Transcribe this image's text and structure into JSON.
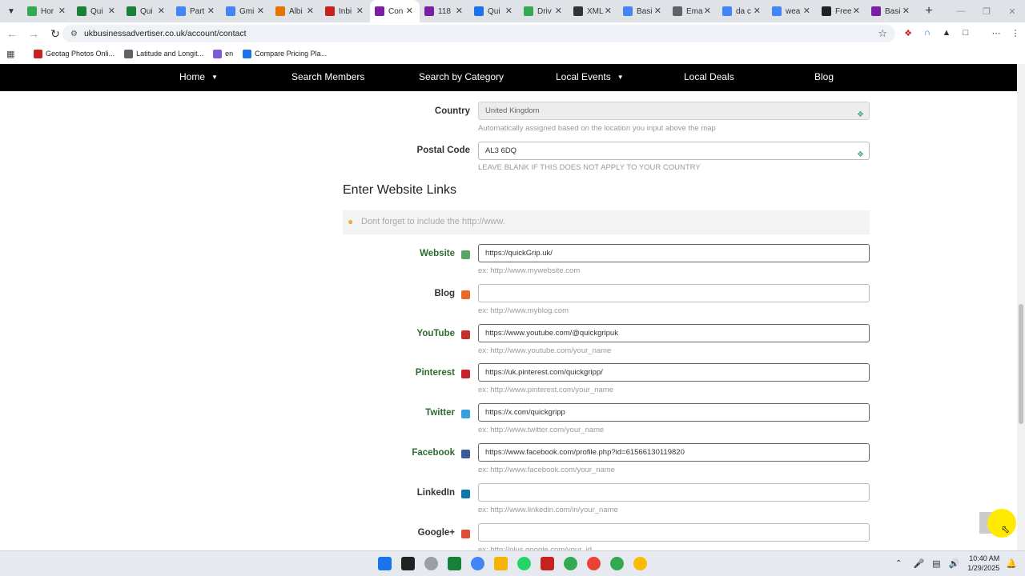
{
  "browser": {
    "tabs": [
      {
        "title": "Hor",
        "color": "#34a853"
      },
      {
        "title": "Qui",
        "color": "#188038"
      },
      {
        "title": "Qui",
        "color": "#188038"
      },
      {
        "title": "Part",
        "color": "#4285f4"
      },
      {
        "title": "Gmi",
        "color": "#4285f4"
      },
      {
        "title": "Albi",
        "color": "#e37400"
      },
      {
        "title": "Inbi",
        "color": "#c5221f"
      },
      {
        "title": "Con",
        "color": "#7b1fa2",
        "active": true
      },
      {
        "title": "118",
        "color": "#7b1fa2"
      },
      {
        "title": "Qui",
        "color": "#1a73e8"
      },
      {
        "title": "Driv",
        "color": "#34a853"
      },
      {
        "title": "XML",
        "color": "#333333"
      },
      {
        "title": "Basi",
        "color": "#4285f4"
      },
      {
        "title": "Ema",
        "color": "#5f6368"
      },
      {
        "title": "da c",
        "color": "#4285f4"
      },
      {
        "title": "wea",
        "color": "#4285f4"
      },
      {
        "title": "Free",
        "color": "#202124"
      },
      {
        "title": "Basi",
        "color": "#7b1fa2"
      }
    ],
    "new_tab": "+",
    "url": "ukbusinessadvertiser.co.uk/account/contact",
    "bookmarks": [
      {
        "label": "Geotag Photos Onli...",
        "color": "#c5221f"
      },
      {
        "label": "Latitude and Longit...",
        "color": "#5f6368"
      },
      {
        "label": "en",
        "color": "#7b5bd6"
      },
      {
        "label": "Compare Pricing Pla...",
        "color": "#1a73e8"
      }
    ]
  },
  "site_nav": {
    "items": [
      "Home",
      "Search Members",
      "Search by Category",
      "Local Events",
      "Local Deals",
      "Blog"
    ]
  },
  "location": {
    "country_label": "Country",
    "country_value": "United Kingdom",
    "country_help": "Automatically assigned based on the location you input above the map",
    "postal_label": "Postal Code",
    "postal_value": "AL3 6DQ",
    "postal_help": "LEAVE BLANK IF THIS DOES NOT APPLY TO YOUR COUNTRY"
  },
  "links": {
    "section_title": "Enter Website Links",
    "tip": "Dont forget to include the http://www.",
    "rows": [
      {
        "label": "Website",
        "value": "https://quickGrip.uk/",
        "help": "ex: http://www.mywebsite.com",
        "icon_color": "#5aa469",
        "icon": "website-icon"
      },
      {
        "label": "Blog",
        "value": "",
        "help": "ex: http://www.myblog.com",
        "icon_color": "#e86a2b",
        "icon": "blog-icon"
      },
      {
        "label": "YouTube",
        "value": "https://www.youtube.com/@quickgripuk",
        "help": "ex: http://www.youtube.com/your_name",
        "icon_color": "#c4302b",
        "icon": "youtube-icon"
      },
      {
        "label": "Pinterest",
        "value": "https://uk.pinterest.com/quickgripp/",
        "help": "ex: http://www.pinterest.com/your_name",
        "icon_color": "#c8232c",
        "icon": "pinterest-icon"
      },
      {
        "label": "Twitter",
        "value": "https://x.com/quickgripp",
        "help": "ex: http://www.twitter.com/your_name",
        "icon_color": "#3a9fdd",
        "icon": "twitter-icon"
      },
      {
        "label": "Facebook",
        "value": "https://www.facebook.com/profile.php?id=61566130119820",
        "help": "ex: http://www.facebook.com/your_name",
        "icon_color": "#3b5998",
        "icon": "facebook-icon"
      },
      {
        "label": "LinkedIn",
        "value": "",
        "help": "ex: http://www.linkedin.com/in/your_name",
        "icon_color": "#0e76a8",
        "icon": "linkedin-icon"
      },
      {
        "label": "Google+",
        "value": "",
        "help": "ex: http://plus.google.com/your_id",
        "icon_color": "#dd4b39",
        "icon": "googleplus-icon"
      }
    ]
  },
  "taskbar": {
    "time": "10:40 AM",
    "date": "1/29/2025"
  }
}
